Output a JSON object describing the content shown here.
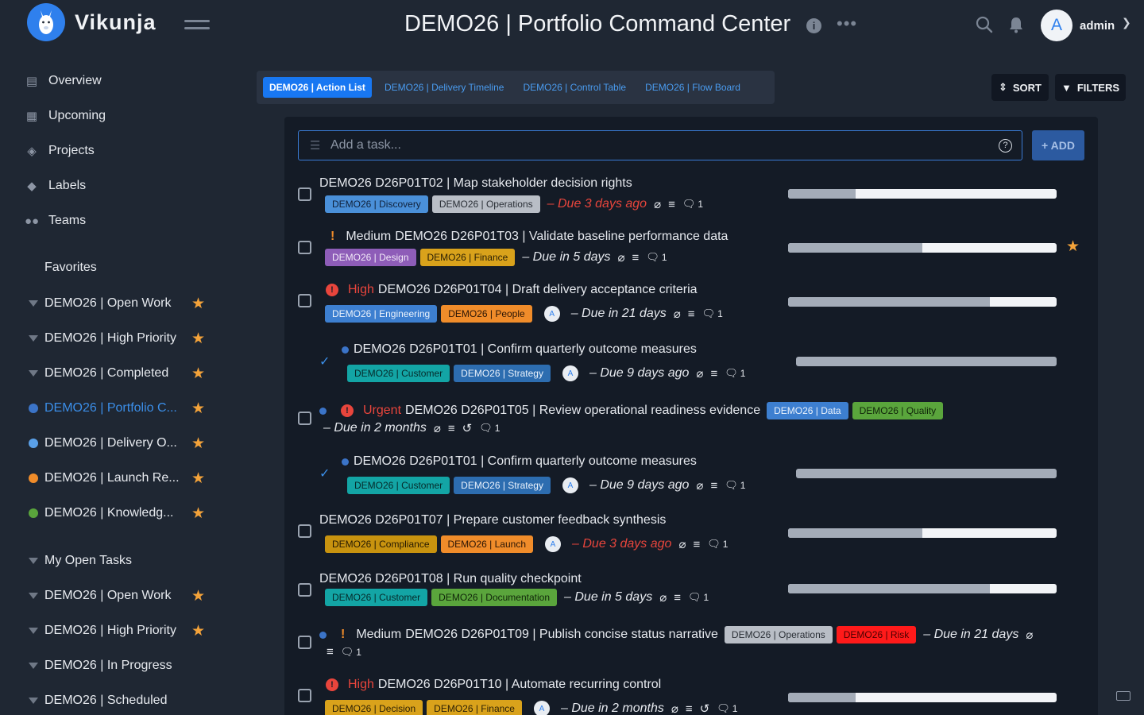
{
  "app": {
    "name": "Vikunja",
    "logo_glyph": "🦙"
  },
  "header": {
    "title": "DEMO26 | Portfolio Command Center",
    "user": "admin",
    "avatar_initial": "A"
  },
  "nav": [
    {
      "label": "Overview",
      "icon": "calendar-icon"
    },
    {
      "label": "Upcoming",
      "icon": "calendar-grid-icon"
    },
    {
      "label": "Projects",
      "icon": "layers-icon"
    },
    {
      "label": "Labels",
      "icon": "tags-icon"
    },
    {
      "label": "Teams",
      "icon": "users-icon"
    }
  ],
  "favorites": {
    "heading": "Favorites",
    "items": [
      {
        "label": "DEMO26 | Open Work",
        "kind": "filter",
        "starred": true
      },
      {
        "label": "DEMO26 | High Priority",
        "kind": "filter",
        "starred": true
      },
      {
        "label": "DEMO26 | Completed",
        "kind": "filter",
        "starred": true
      },
      {
        "label": "DEMO26 | Portfolio C...",
        "kind": "dot",
        "color": "#3b74c8",
        "starred": true,
        "active": true
      },
      {
        "label": "DEMO26 | Delivery O...",
        "kind": "dot",
        "color": "#5aa0e8",
        "starred": true
      },
      {
        "label": "DEMO26 | Launch Re...",
        "kind": "dot",
        "color": "#f08c2a",
        "starred": true
      },
      {
        "label": "DEMO26 | Knowledg...",
        "kind": "dot",
        "color": "#5aa53c",
        "starred": true
      }
    ]
  },
  "projects": [
    {
      "label": "My Open Tasks",
      "kind": "filter",
      "starred": false
    },
    {
      "label": "DEMO26 | Open Work",
      "kind": "filter",
      "starred": true
    },
    {
      "label": "DEMO26 | High Priority",
      "kind": "filter",
      "starred": true
    },
    {
      "label": "DEMO26 | In Progress",
      "kind": "filter",
      "starred": false
    },
    {
      "label": "DEMO26 | Scheduled",
      "kind": "filter",
      "starred": false
    }
  ],
  "views": [
    {
      "label": "DEMO26 | Action List",
      "active": true
    },
    {
      "label": "DEMO26 | Delivery Timeline",
      "active": false
    },
    {
      "label": "DEMO26 | Control Table",
      "active": false
    },
    {
      "label": "DEMO26 | Flow Board",
      "active": false
    }
  ],
  "toolbar": {
    "sort": "SORT",
    "filters": "FILTERS"
  },
  "add_task": {
    "placeholder": "Add a task...",
    "button": "+ ADD"
  },
  "tasks": [
    {
      "title": "DEMO26 D26P01T02 | Map stakeholder decision rights",
      "labels": [
        [
          "DEMO26 | Discovery",
          "#4a90d9",
          "#10213a"
        ],
        [
          "DEMO26 | Operations",
          "#b9bec6",
          "#2a2f36"
        ]
      ],
      "due": "– Due 3 days ago",
      "overdue": true,
      "comments": "1",
      "progress": 0.25
    },
    {
      "priority": "Medium",
      "title": "DEMO26 D26P01T03 | Validate baseline performance data",
      "labels": [
        [
          "DEMO26 | Design",
          "#8e5db8",
          "#f2eaf8"
        ],
        [
          "DEMO26 | Finance",
          "#d9a21b",
          "#2a1f05"
        ]
      ],
      "due": "– Due in 5 days",
      "overdue": false,
      "comments": "1",
      "progress": 0.5,
      "starred": true
    },
    {
      "priority": "High",
      "title": "DEMO26 D26P01T04 | Draft delivery acceptance criteria",
      "labels": [
        [
          "DEMO26 | Engineering",
          "#3d7fd0",
          "#eaf2fc"
        ],
        [
          "DEMO26 | People",
          "#f08c2a",
          "#2a1505"
        ]
      ],
      "assignee": "A",
      "due": "– Due in 21 days",
      "overdue": false,
      "comments": "1",
      "progress": 0.75
    },
    {
      "title": "DEMO26 D26P01T01 | Confirm quarterly outcome measures",
      "labels": [
        [
          "DEMO26 | Customer",
          "#13a5a5",
          "#062a2a"
        ],
        [
          "DEMO26 | Strategy",
          "#2d6db0",
          "#eaf2fc"
        ]
      ],
      "assignee": "A",
      "due": "– Due 9 days ago",
      "overdue": false,
      "comments": "1",
      "progress": 1.0
    },
    {
      "priority": "Urgent",
      "title": "DEMO26 D26P01T05 | Review operational readiness evidence",
      "labels": [
        [
          "DEMO26 | Data",
          "#3d7fd0",
          "#eaf2fc"
        ],
        [
          "DEMO26 | Quality",
          "#5aa53c",
          "#10250a"
        ]
      ],
      "due": "– Due in 2 months",
      "overdue": false,
      "comments": "1"
    },
    {
      "title": "DEMO26 D26P01T01 | Confirm quarterly outcome measures",
      "labels": [
        [
          "DEMO26 | Customer",
          "#13a5a5",
          "#062a2a"
        ],
        [
          "DEMO26 | Strategy",
          "#2d6db0",
          "#eaf2fc"
        ]
      ],
      "assignee": "A",
      "due": "– Due 9 days ago",
      "overdue": false,
      "comments": "1",
      "progress": 1.0
    },
    {
      "title": "DEMO26 D26P01T07 | Prepare customer feedback synthesis",
      "labels": [
        [
          "DEMO26 | Compliance",
          "#c8930f",
          "#261a02"
        ],
        [
          "DEMO26 | Launch",
          "#f08c2a",
          "#2a1505"
        ]
      ],
      "assignee": "A",
      "due": "– Due 3 days ago",
      "overdue": true,
      "comments": "1",
      "progress": 0.5
    },
    {
      "title": "DEMO26 D26P01T08 | Run quality checkpoint",
      "labels": [
        [
          "DEMO26 | Customer",
          "#13a5a5",
          "#062a2a"
        ],
        [
          "DEMO26 | Documentation",
          "#5aa53c",
          "#10250a"
        ]
      ],
      "due": "– Due in 5 days",
      "overdue": false,
      "comments": "1",
      "progress": 0.75
    },
    {
      "priority": "Medium",
      "title": "DEMO26 D26P01T09 | Publish concise status narrative",
      "labels": [
        [
          "DEMO26 | Operations",
          "#b9bec6",
          "#2a2f36"
        ],
        [
          "DEMO26 | Risk",
          "#ff1a1a",
          "#4a0000"
        ]
      ],
      "due": "– Due in 21 days",
      "overdue": false,
      "comments": "1"
    },
    {
      "priority": "High",
      "title": "DEMO26 D26P01T10 | Automate recurring control",
      "labels": [
        [
          "DEMO26 | Decision",
          "#d9a21b",
          "#2a1f05"
        ],
        [
          "DEMO26 | Finance",
          "#d9a21b",
          "#2a1f05"
        ]
      ],
      "assignee": "A",
      "due": "– Due in 2 months",
      "overdue": false,
      "comments": "1",
      "progress": 0.25
    }
  ]
}
